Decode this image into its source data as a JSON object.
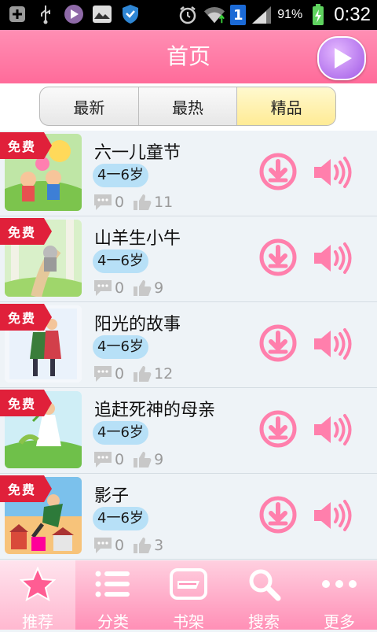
{
  "status_bar": {
    "battery_percent": "91%",
    "time": "0:32",
    "sim_slot": "1"
  },
  "header": {
    "title": "首页"
  },
  "tabs": [
    {
      "label": "最新",
      "active": false
    },
    {
      "label": "最热",
      "active": false
    },
    {
      "label": "精品",
      "active": true
    }
  ],
  "stories": [
    {
      "badge": "免费",
      "title": "六一儿童节",
      "age": "4一6岁",
      "comments": "0",
      "likes": "11"
    },
    {
      "badge": "免费",
      "title": "山羊生小牛",
      "age": "4一6岁",
      "comments": "0",
      "likes": "9"
    },
    {
      "badge": "免费",
      "title": "阳光的故事",
      "age": "4一6岁",
      "comments": "0",
      "likes": "12"
    },
    {
      "badge": "免费",
      "title": "追赶死神的母亲",
      "age": "4一6岁",
      "comments": "0",
      "likes": "9"
    },
    {
      "badge": "免费",
      "title": "影子",
      "age": "4一6岁",
      "comments": "0",
      "likes": "3"
    }
  ],
  "bottom_nav": [
    {
      "label": "推荐",
      "icon": "star-icon",
      "active": true
    },
    {
      "label": "分类",
      "icon": "list-icon",
      "active": false
    },
    {
      "label": "书架",
      "icon": "bookshelf-icon",
      "active": false
    },
    {
      "label": "搜索",
      "icon": "search-icon",
      "active": false
    },
    {
      "label": "更多",
      "icon": "more-icon",
      "active": false
    }
  ],
  "colors": {
    "accent_pink": "#ff6b9a",
    "play_purple": "#a15ae6",
    "age_badge": "#b7e0f7",
    "active_tab": "#ffeb95"
  }
}
